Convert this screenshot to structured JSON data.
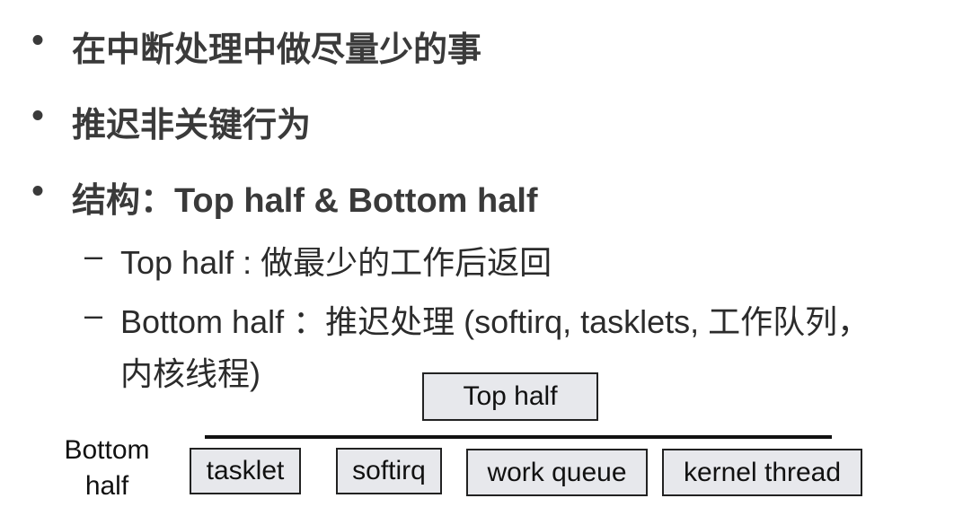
{
  "bullets": [
    {
      "marker": "•",
      "text": "在中断处理中做尽量少的事"
    },
    {
      "marker": "•",
      "text": "推迟非关键行为"
    },
    {
      "marker": "•",
      "text": "结构：Top half & Bottom half"
    }
  ],
  "sub_items": [
    {
      "marker": "–",
      "text": "Top half : 做最少的工作后返回"
    },
    {
      "marker": "–",
      "text": "Bottom half  ：推迟处理 (softirq, tasklets, 工作队列，",
      "continuation": "内核线程)"
    }
  ],
  "diagram": {
    "top_box": "Top half",
    "side_label_line1": "Bottom",
    "side_label_line2": "half",
    "boxes": [
      "tasklet",
      "softirq",
      "work queue",
      "kernel thread"
    ]
  }
}
